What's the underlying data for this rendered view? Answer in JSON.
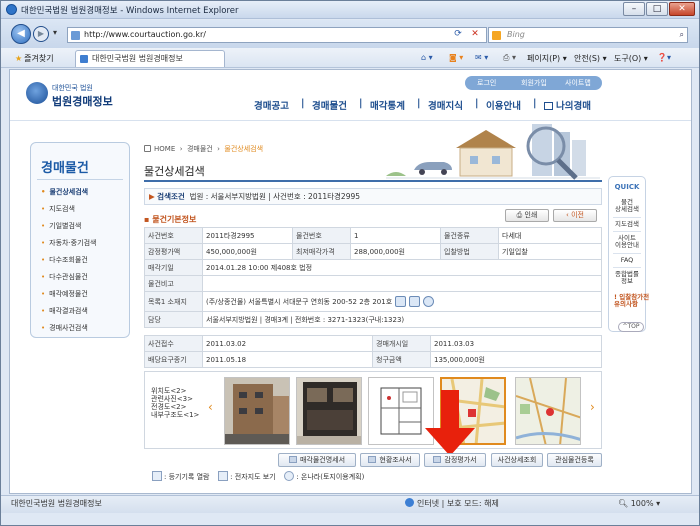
{
  "browser": {
    "window_title": "대한민국법원 법원경매정보 - Windows Internet Explorer",
    "url": "http://www.courtauction.go.kr/",
    "search_placeholder": "Bing",
    "favorites_label": "즐겨찾기",
    "tab_title": "대한민국법원 법원경매정보",
    "tools": {
      "page": "페이지(P)",
      "safety": "안전(S)",
      "tools": "도구(O)"
    },
    "status_left": "대한민국법원 법원경매정보",
    "status_zone": "인터넷 | 보호 모드: 해제",
    "zoom": "100%"
  },
  "site": {
    "logo_small": "대한민국 법원",
    "logo_big": "법원경매정보",
    "top_links": [
      "로그인",
      "회원가입",
      "사이트맵"
    ],
    "gnb": [
      "경매공고",
      "경매물건",
      "매각통계",
      "경매지식",
      "이용안내",
      "나의경매"
    ]
  },
  "lnb": {
    "title": "경매물건",
    "items": [
      "물건상세검색",
      "지도검색",
      "기일별검색",
      "자동차·중기검색",
      "다수조회물건",
      "다수관심물건",
      "매각예정물건",
      "매각결과검색",
      "경매사건검색"
    ]
  },
  "breadcrumb": [
    "HOME",
    "경매물건",
    "물건상세검색"
  ],
  "page_title": "물건상세검색",
  "condition": {
    "label": "검색조건",
    "text": "법원 : 서울서부지방법원 | 사건번호 : 2011타경2995"
  },
  "section_title": "물건기본정보",
  "buttons": {
    "print": "인쇄",
    "prev": "이전"
  },
  "info": {
    "case_no_label": "사건번호",
    "case_no": "2011타경2995",
    "item_no_label": "물건번호",
    "item_no": "1",
    "item_type_label": "물건종류",
    "item_type": "다세대",
    "appraisal_label": "감정평가액",
    "appraisal": "450,000,000원",
    "min_price_label": "최저매각가격",
    "min_price": "288,000,000원",
    "bid_method_label": "입찰방법",
    "bid_method": "기일입찰",
    "sale_date_label": "매각기일",
    "sale_date": "2014.01.28 10:00 제408호 법정",
    "note_label": "물건비고",
    "note": "",
    "address_label": "목록1 소재지",
    "address": "(주/상종건물) 서울특별시 서대문구 연희동 200-52 2층 201호",
    "manager_label": "담당",
    "manager": "서울서부지방법원 | 경매3계 | 전화번호 : 3271-1323(구내:1323)"
  },
  "info2": {
    "received_label": "사건접수",
    "received": "2011.03.02",
    "start_label": "경매개시일",
    "start": "2011.03.03",
    "deadline_label": "배당요구종기",
    "deadline": "2011.05.18",
    "claim_label": "청구금액",
    "claim": "135,000,000원"
  },
  "photo_labels": [
    "위치도<2>",
    "관련사진<3>",
    "전경도<2>",
    "내부구조도<1>"
  ],
  "bottom_buttons": [
    "매각물건명세서",
    "현황조사서",
    "감정평가서",
    "사건상세조회",
    "관심물건등록"
  ],
  "legend": {
    "a": "등기기록 열람",
    "b": "전자지도 보기",
    "c": "온나라(토지이용계획)"
  },
  "quick": {
    "title": "QUICK",
    "items": [
      "물건\n상세검색",
      "지도검색",
      "사이트\n이용안내",
      "FAQ",
      "종합법률\n정보"
    ],
    "notice": "입찰참가전\n유의사항",
    "top": "TOP"
  },
  "colors": {
    "accent": "#1b5aa6",
    "orange": "#e08a1e",
    "red_arrow": "#e8210c"
  }
}
